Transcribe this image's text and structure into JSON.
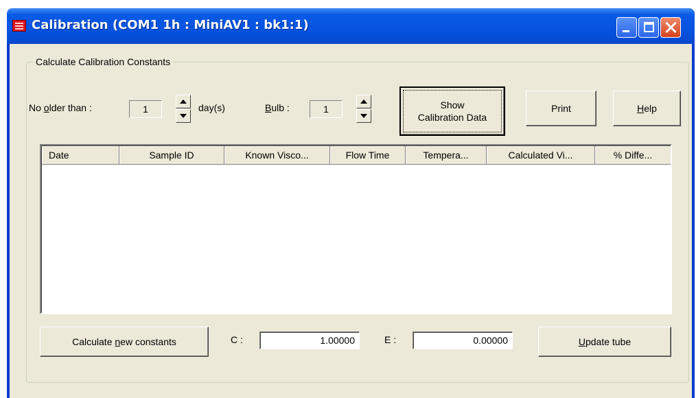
{
  "window": {
    "title": "Calibration (COM1 1h : MiniAV1 : bk1:1)"
  },
  "group": {
    "label": "Calculate Calibration Constants"
  },
  "controls": {
    "no_older_than": {
      "label_pre": "No ",
      "label_acc": "o",
      "label_post": "lder than :",
      "value": "1",
      "unit": "day(s)"
    },
    "bulb": {
      "label_acc": "B",
      "label_post": "ulb :",
      "value": "1"
    }
  },
  "buttons": {
    "show_line1": "Show",
    "show_line2": "Calibration Data",
    "print": "Print",
    "help_acc": "H",
    "help_post": "elp",
    "calc_pre": "Calculate ",
    "calc_acc": "n",
    "calc_post": "ew constants",
    "update_acc": "U",
    "update_post": "pdate tube"
  },
  "table": {
    "columns": [
      "Date",
      "Sample ID",
      "Known Visco...",
      "Flow Time",
      "Tempera...",
      "Calculated Vi...",
      "% Diffe..."
    ],
    "rows": []
  },
  "constants": {
    "c_label": "C :",
    "c_value": "1.00000",
    "e_label": "E :",
    "e_value": "0.00000"
  }
}
